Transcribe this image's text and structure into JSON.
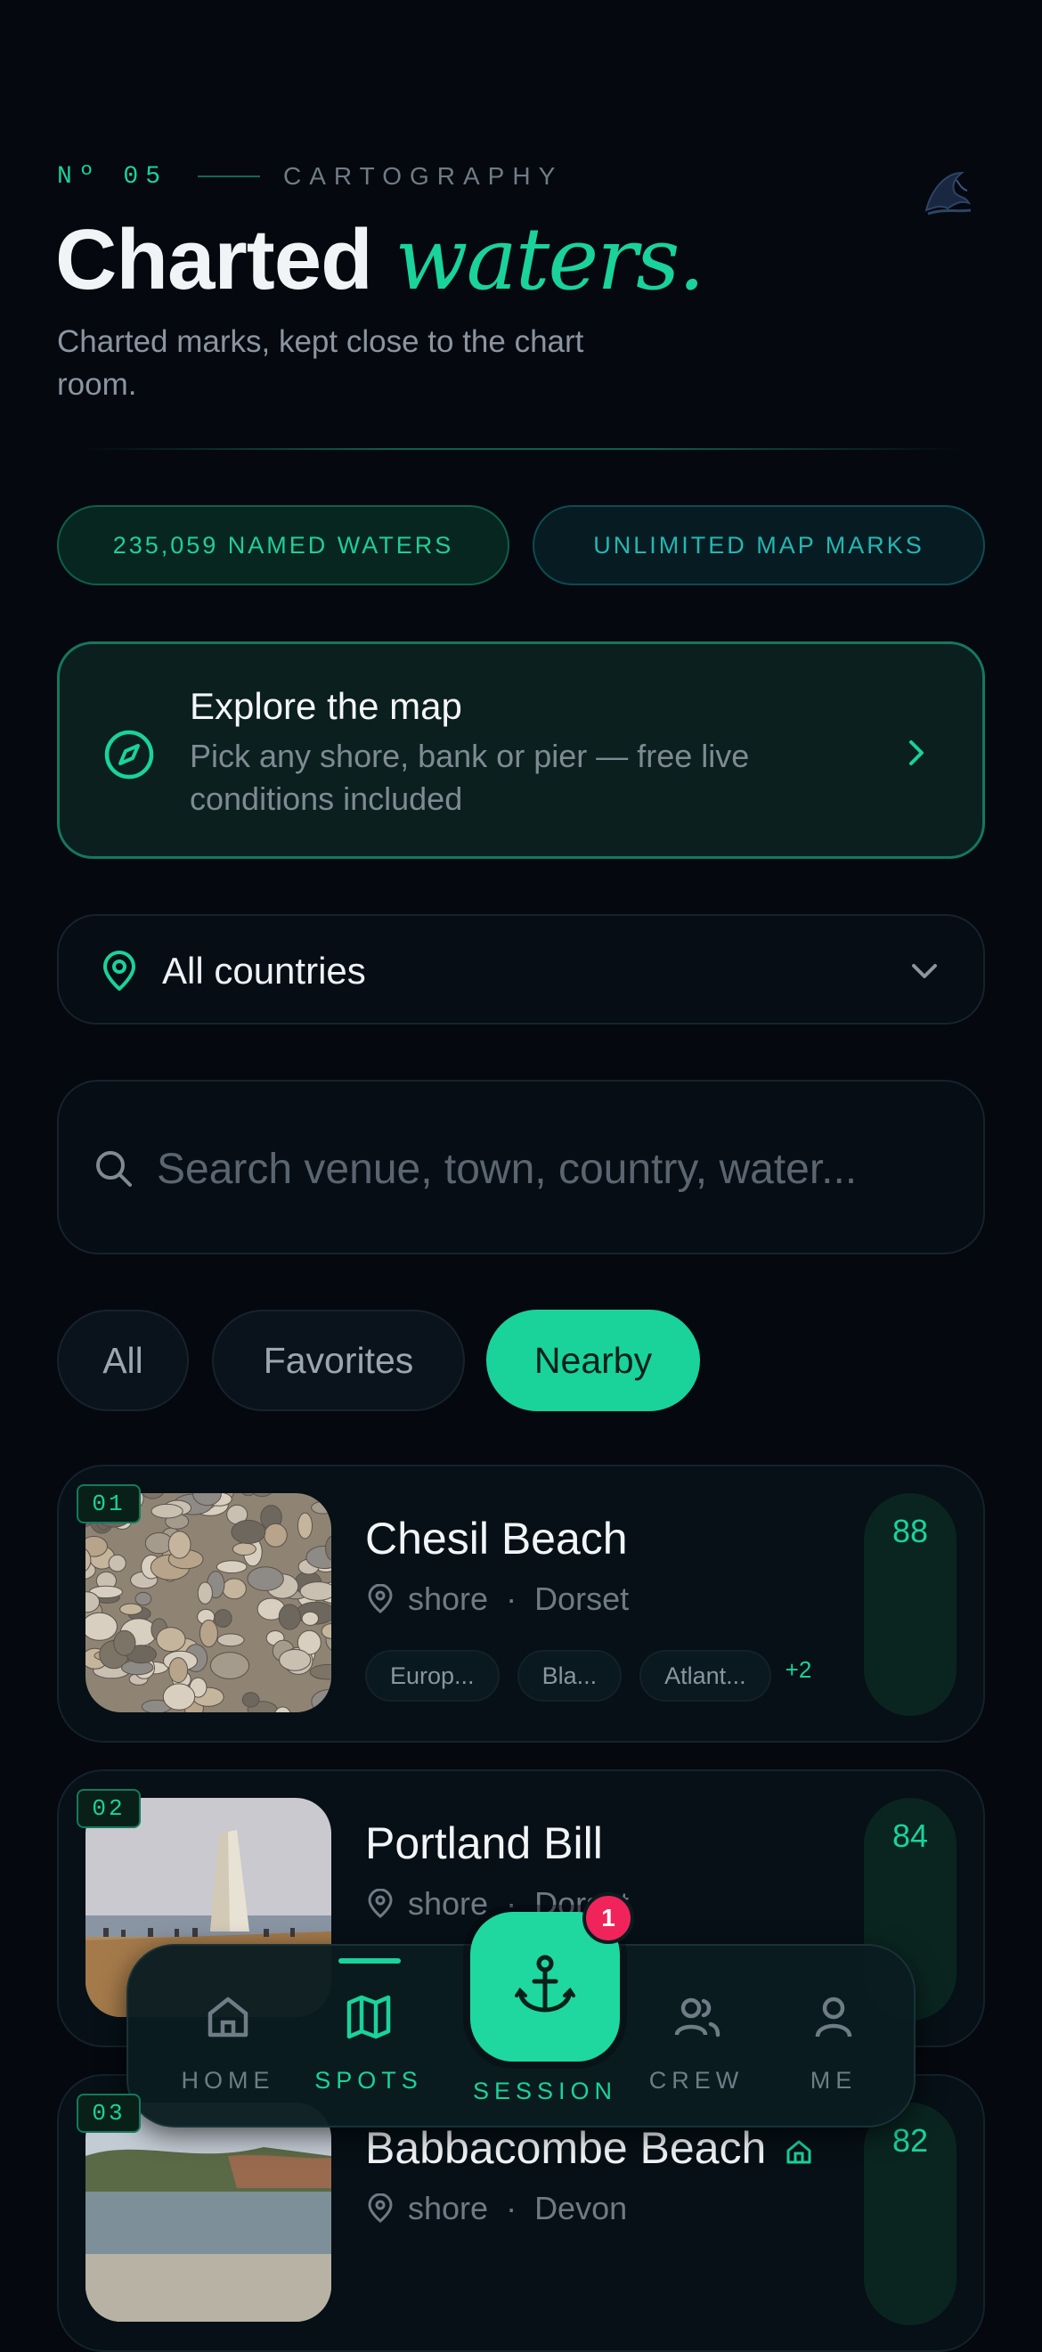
{
  "header": {
    "issue_number": "Nº 05",
    "section": "CARTOGRAPHY",
    "title_main": "Charted",
    "title_accent": "waters.",
    "subtitle": "Charted marks, kept close to the chart room."
  },
  "stats": {
    "named_waters": "235,059 NAMED WATERS",
    "map_marks": "UNLIMITED MAP MARKS"
  },
  "explore": {
    "title": "Explore the map",
    "description": "Pick any shore, bank or pier — free live conditions included",
    "icon": "compass-icon"
  },
  "country_select": {
    "value": "All countries"
  },
  "search": {
    "placeholder": "Search venue, town, country, water..."
  },
  "filters": [
    {
      "label": "All",
      "active": false
    },
    {
      "label": "Favorites",
      "active": false
    },
    {
      "label": "Nearby",
      "active": true
    }
  ],
  "spots": [
    {
      "rank": "01",
      "name": "Chesil Beach",
      "type": "shore",
      "region": "Dorset",
      "tags": [
        "Europ...",
        "Bla...",
        "Atlant..."
      ],
      "more": "+2",
      "score": "88"
    },
    {
      "rank": "02",
      "name": "Portland Bill",
      "type": "shore",
      "region": "Dorset",
      "score": "84"
    },
    {
      "rank": "03",
      "name": "Babbacombe Beach",
      "type": "shore",
      "region": "Devon",
      "score": "82"
    }
  ],
  "nav": {
    "home": "HOME",
    "spots": "SPOTS",
    "session": "SESSION",
    "crew": "CREW",
    "me": "ME",
    "session_badge": "1",
    "active": "spots"
  },
  "colors": {
    "background": "#05080f",
    "accent": "#19d39a",
    "badge": "#f0245a",
    "muted": "#6f7c86"
  }
}
